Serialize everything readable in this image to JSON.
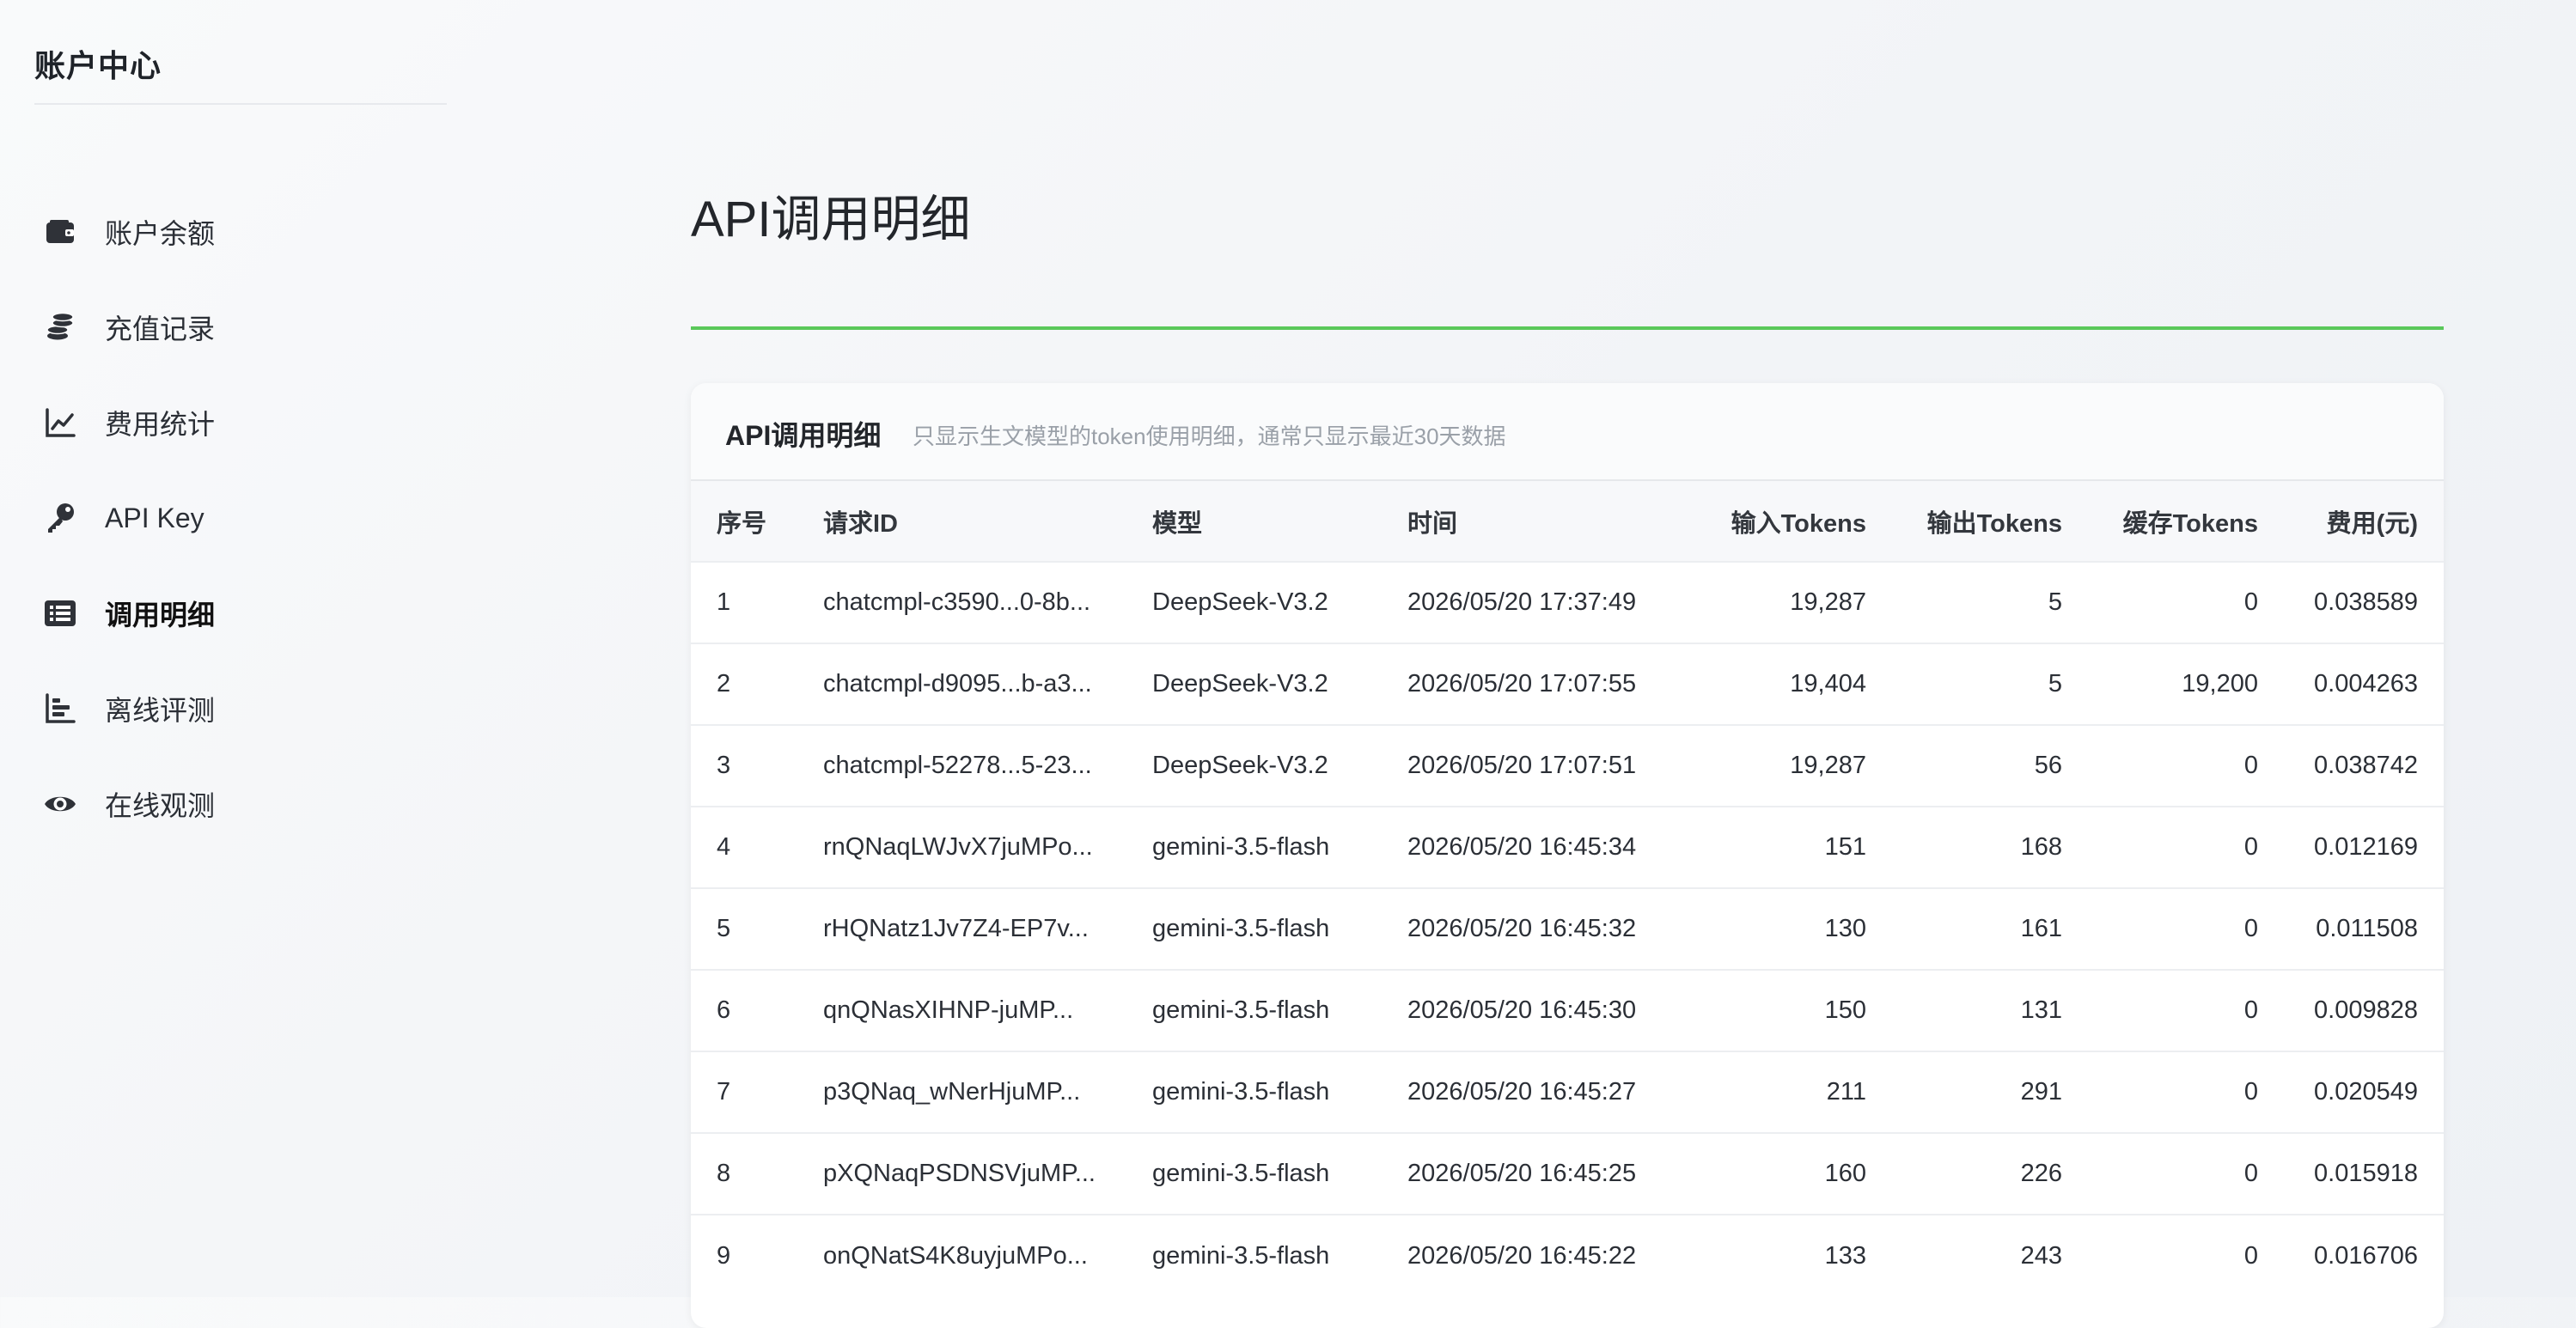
{
  "sidebar": {
    "brand": "账户中心",
    "items": [
      {
        "label": "账户余额",
        "icon": "wallet-icon"
      },
      {
        "label": "充值记录",
        "icon": "coins-icon"
      },
      {
        "label": "费用统计",
        "icon": "line-chart-icon"
      },
      {
        "label": "API Key",
        "icon": "key-icon"
      },
      {
        "label": "调用明细",
        "icon": "list-icon",
        "active": true
      },
      {
        "label": "离线评测",
        "icon": "bar-chart-icon"
      },
      {
        "label": "在线观测",
        "icon": "eye-icon"
      }
    ]
  },
  "main": {
    "page_title": "API调用明细",
    "accent_color": "#5ac85a",
    "card": {
      "title": "API调用明细",
      "subtitle": "只显示生文模型的token使用明细，通常只显示最近30天数据"
    },
    "table": {
      "columns": [
        "序号",
        "请求ID",
        "模型",
        "时间",
        "输入Tokens",
        "输出Tokens",
        "缓存Tokens",
        "费用(元)"
      ],
      "rows": [
        [
          "1",
          "chatcmpl-c3590...0-8b...",
          "DeepSeek-V3.2",
          "2026/05/20 17:37:49",
          "19,287",
          "5",
          "0",
          "0.038589"
        ],
        [
          "2",
          "chatcmpl-d9095...b-a3...",
          "DeepSeek-V3.2",
          "2026/05/20 17:07:55",
          "19,404",
          "5",
          "19,200",
          "0.004263"
        ],
        [
          "3",
          "chatcmpl-52278...5-23...",
          "DeepSeek-V3.2",
          "2026/05/20 17:07:51",
          "19,287",
          "56",
          "0",
          "0.038742"
        ],
        [
          "4",
          "rnQNaqLWJvX7juMPo...",
          "gemini-3.5-flash",
          "2026/05/20 16:45:34",
          "151",
          "168",
          "0",
          "0.012169"
        ],
        [
          "5",
          "rHQNatz1Jv7Z4-EP7v...",
          "gemini-3.5-flash",
          "2026/05/20 16:45:32",
          "130",
          "161",
          "0",
          "0.011508"
        ],
        [
          "6",
          "qnQNasXIHNP-juMP...",
          "gemini-3.5-flash",
          "2026/05/20 16:45:30",
          "150",
          "131",
          "0",
          "0.009828"
        ],
        [
          "7",
          "p3QNaq_wNerHjuMP...",
          "gemini-3.5-flash",
          "2026/05/20 16:45:27",
          "211",
          "291",
          "0",
          "0.020549"
        ],
        [
          "8",
          "pXQNaqPSDNSVjuMP...",
          "gemini-3.5-flash",
          "2026/05/20 16:45:25",
          "160",
          "226",
          "0",
          "0.015918"
        ],
        [
          "9",
          "onQNatS4K8uyjuMPo...",
          "gemini-3.5-flash",
          "2026/05/20 16:45:22",
          "133",
          "243",
          "0",
          "0.016706"
        ]
      ]
    }
  }
}
